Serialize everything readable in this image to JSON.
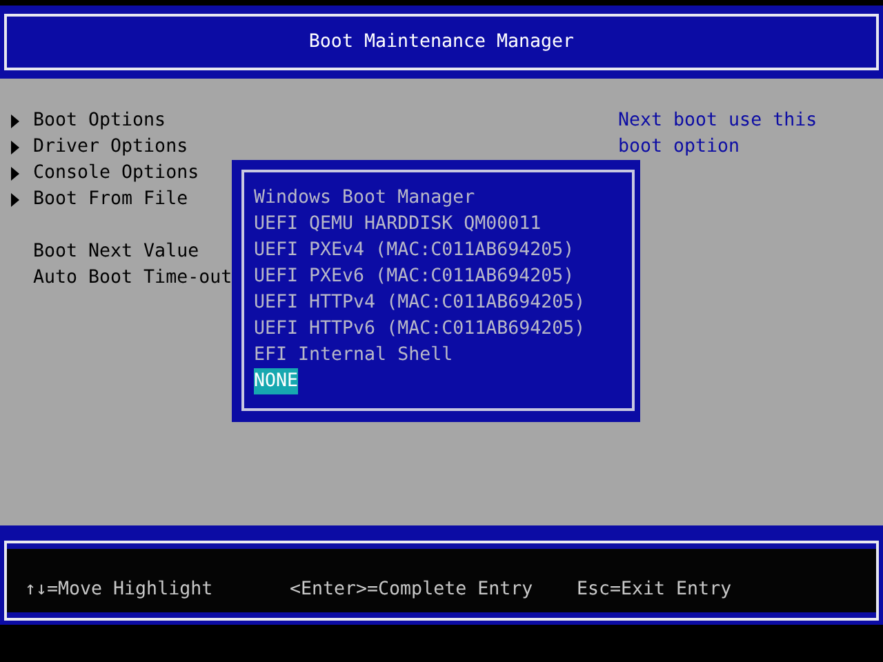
{
  "header": {
    "title": "Boot Maintenance Manager"
  },
  "menu": [
    {
      "label": "Boot Options",
      "kind": "submenu"
    },
    {
      "label": "Driver Options",
      "kind": "submenu"
    },
    {
      "label": "Console Options",
      "kind": "submenu"
    },
    {
      "label": "Boot From File",
      "kind": "submenu"
    },
    {
      "label": "Boot Next Value",
      "kind": "setting"
    },
    {
      "label": "Auto Boot Time-out",
      "kind": "setting"
    }
  ],
  "help_text": [
    "Next boot use this",
    "boot option"
  ],
  "popup": {
    "options": [
      {
        "label": "Windows Boot Manager",
        "selected": false
      },
      {
        "label": "UEFI QEMU HARDDISK QM00011",
        "selected": false
      },
      {
        "label": "UEFI PXEv4 (MAC:C011AB694205)",
        "selected": false
      },
      {
        "label": "UEFI PXEv6 (MAC:C011AB694205)",
        "selected": false
      },
      {
        "label": "UEFI HTTPv4 (MAC:C011AB694205)",
        "selected": false
      },
      {
        "label": "UEFI HTTPv6 (MAC:C011AB694205)",
        "selected": false
      },
      {
        "label": "EFI Internal Shell",
        "selected": false
      },
      {
        "label": "NONE",
        "selected": true
      }
    ]
  },
  "footer": {
    "hints": [
      "↑↓=Move Highlight",
      "<Enter>=Complete Entry",
      "Esc=Exit Entry"
    ]
  }
}
